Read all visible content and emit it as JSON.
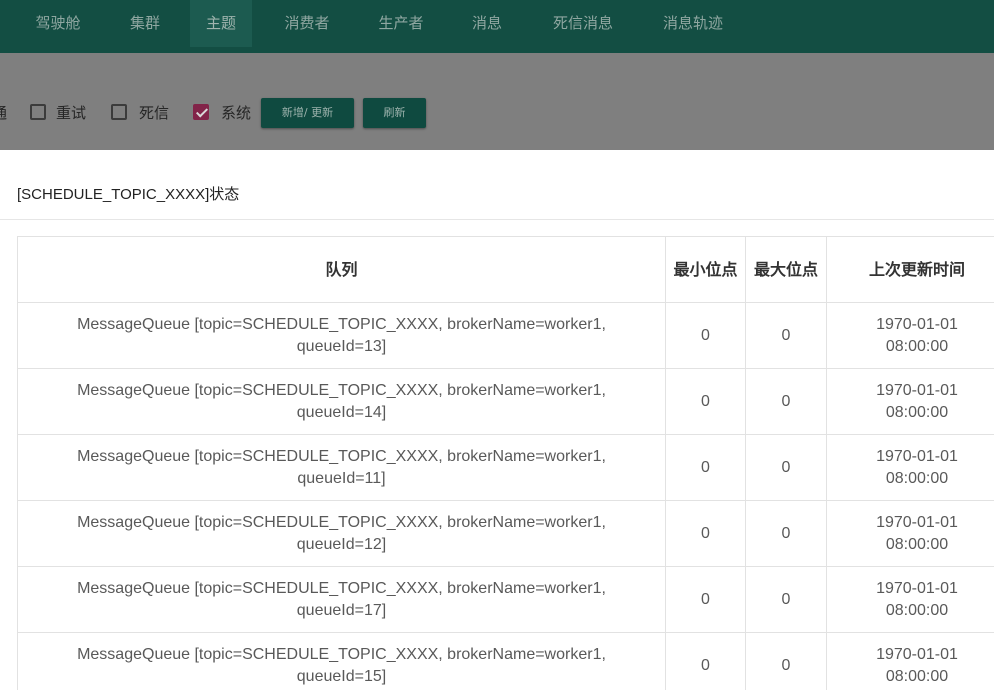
{
  "nav": {
    "items": [
      {
        "label": "驾驶舱",
        "active": false
      },
      {
        "label": "集群",
        "active": false
      },
      {
        "label": "主题",
        "active": true
      },
      {
        "label": "消费者",
        "active": false
      },
      {
        "label": "生产者",
        "active": false
      },
      {
        "label": "消息",
        "active": false
      },
      {
        "label": "死信消息",
        "active": false
      },
      {
        "label": "消息轨迹",
        "active": false
      }
    ]
  },
  "toolbar": {
    "partial_label": "通",
    "checkboxes": [
      {
        "label": "重试",
        "checked": false
      },
      {
        "label": "死信",
        "checked": false
      },
      {
        "label": "系统",
        "checked": true
      }
    ],
    "add_update_label": "新增/ 更新",
    "refresh_label": "刷新"
  },
  "modal": {
    "title": "[SCHEDULE_TOPIC_XXXX]状态",
    "columns": [
      "队列",
      "最小位点",
      "最大位点",
      "上次更新时间"
    ],
    "rows": [
      {
        "queue_line1": "MessageQueue [topic=SCHEDULE_TOPIC_XXXX, brokerName=worker1,",
        "queue_line2": "queueId=13]",
        "min": "0",
        "max": "0",
        "date": "1970-01-01",
        "time": "08:00:00"
      },
      {
        "queue_line1": "MessageQueue [topic=SCHEDULE_TOPIC_XXXX, brokerName=worker1,",
        "queue_line2": "queueId=14]",
        "min": "0",
        "max": "0",
        "date": "1970-01-01",
        "time": "08:00:00"
      },
      {
        "queue_line1": "MessageQueue [topic=SCHEDULE_TOPIC_XXXX, brokerName=worker1,",
        "queue_line2": "queueId=11]",
        "min": "0",
        "max": "0",
        "date": "1970-01-01",
        "time": "08:00:00"
      },
      {
        "queue_line1": "MessageQueue [topic=SCHEDULE_TOPIC_XXXX, brokerName=worker1,",
        "queue_line2": "queueId=12]",
        "min": "0",
        "max": "0",
        "date": "1970-01-01",
        "time": "08:00:00"
      },
      {
        "queue_line1": "MessageQueue [topic=SCHEDULE_TOPIC_XXXX, brokerName=worker1,",
        "queue_line2": "queueId=17]",
        "min": "0",
        "max": "0",
        "date": "1970-01-01",
        "time": "08:00:00"
      },
      {
        "queue_line1": "MessageQueue [topic=SCHEDULE_TOPIC_XXXX, brokerName=worker1,",
        "queue_line2": "queueId=15]",
        "min": "0",
        "max": "0",
        "date": "1970-01-01",
        "time": "08:00:00"
      }
    ]
  },
  "colors": {
    "nav_bg": "#134e43",
    "overlay_bg": "#7f7f7f",
    "checkbox_checked": "#822449",
    "button_bg": "#0f4a40"
  }
}
